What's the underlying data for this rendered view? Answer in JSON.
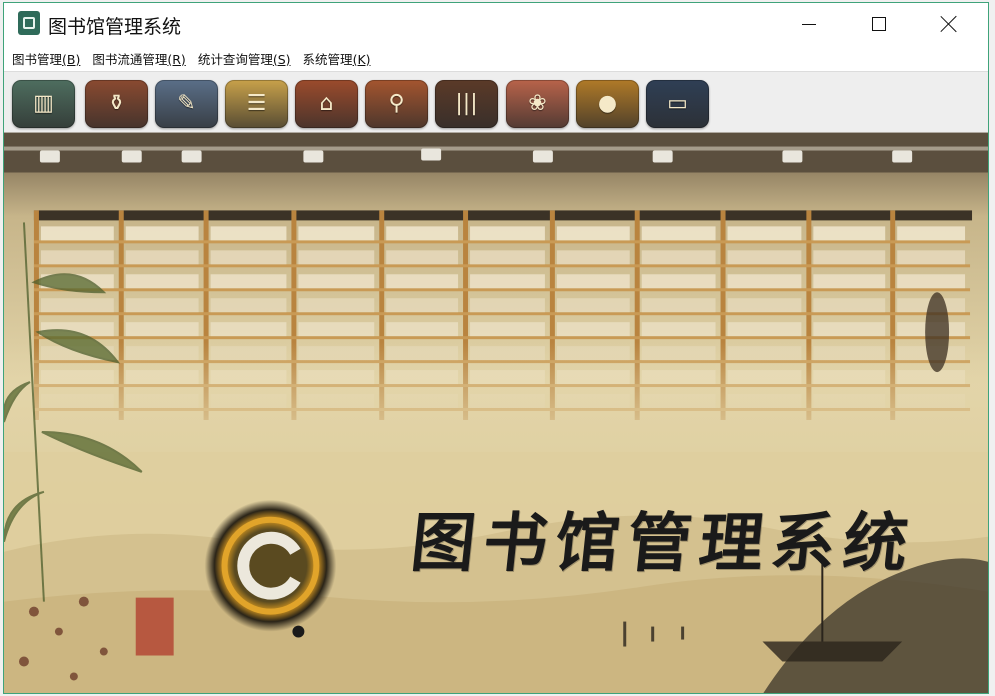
{
  "window": {
    "title": "图书馆管理系统"
  },
  "menu": [
    {
      "label": "图书管理",
      "key": "(B)"
    },
    {
      "label": "图书流通管理",
      "key": "(R)"
    },
    {
      "label": "统计查询管理",
      "key": "(S)"
    },
    {
      "label": "系统管理",
      "key": "(K)"
    }
  ],
  "toolbar": [
    {
      "icon": "bookshelf-icon",
      "glyph": "▥",
      "color": "#4e6e5f"
    },
    {
      "icon": "brush-pot-icon",
      "glyph": "⚱",
      "color": "#8a4a30"
    },
    {
      "icon": "scroll-brush-icon",
      "glyph": "✎",
      "color": "#5a6f88"
    },
    {
      "icon": "thread-bound-book-icon",
      "glyph": "☰",
      "color": "#c8a14a"
    },
    {
      "icon": "scholar-hat-icon",
      "glyph": "⌂",
      "color": "#9b4b2c"
    },
    {
      "icon": "magnifier-icon",
      "glyph": "⚲",
      "color": "#a4552f"
    },
    {
      "icon": "bamboo-slips-icon",
      "glyph": "|||",
      "color": "#5b3a28"
    },
    {
      "icon": "paper-cut-icon",
      "glyph": "❀",
      "color": "#b8634a"
    },
    {
      "icon": "inkstone-icon",
      "glyph": "●",
      "color": "#b07a28"
    },
    {
      "icon": "seal-box-icon",
      "glyph": "▭",
      "color": "#2f3f55"
    }
  ],
  "banner": {
    "text": "图书馆管理系统"
  },
  "colors": {
    "accent_border": "#3fa37a",
    "paper": "#d9c795",
    "shelf_wood": "#b9843f"
  }
}
